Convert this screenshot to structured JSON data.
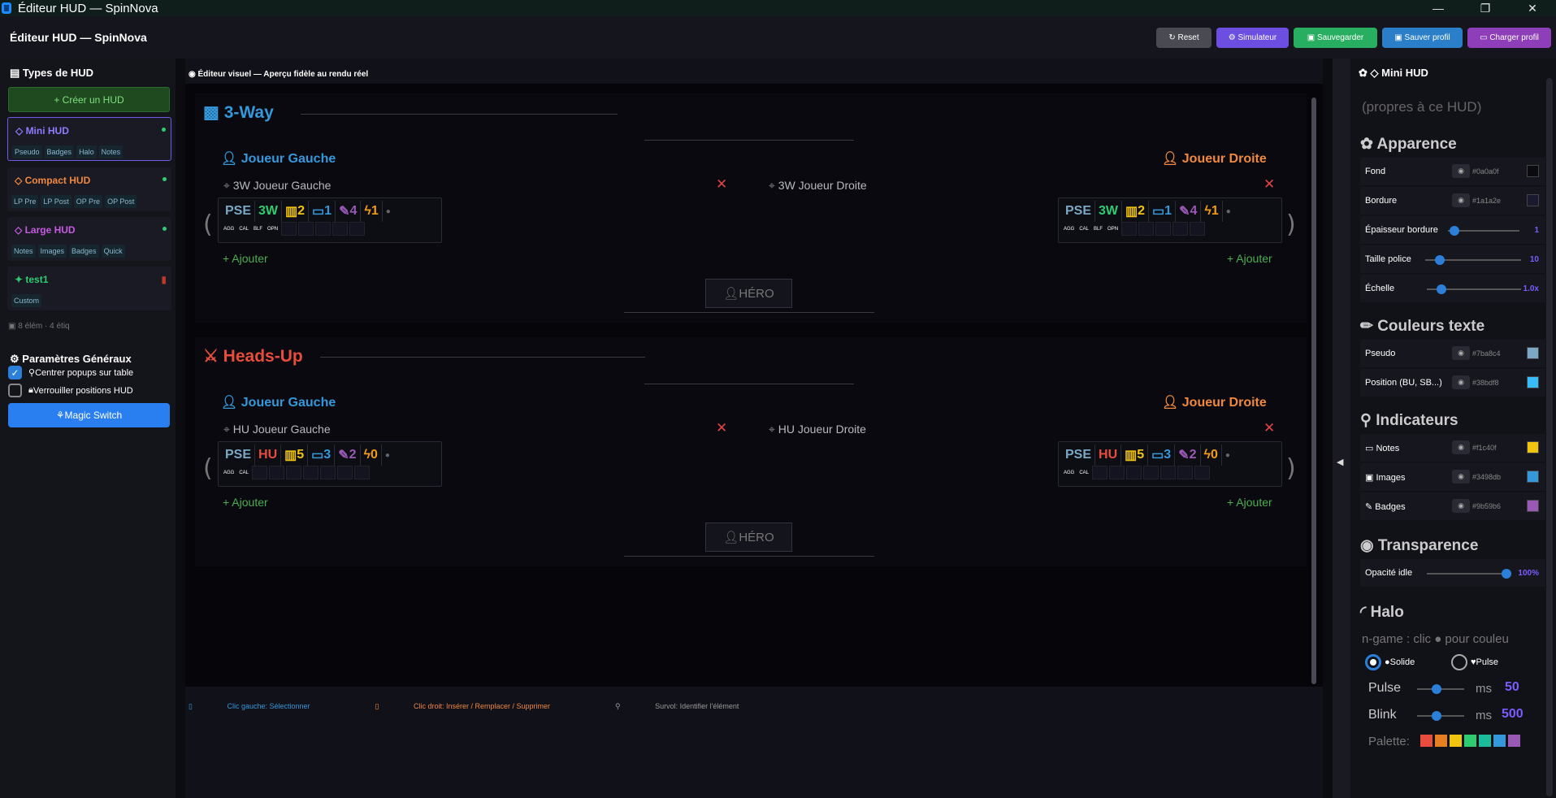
{
  "window": {
    "title": "Éditeur HUD — SpinNova",
    "minimize": "—",
    "maximize": "❐",
    "close": "✕"
  },
  "header": {
    "title": "Éditeur HUD — SpinNova",
    "buttons": [
      "↻ Reset",
      "⚙ Simulateur",
      "▣ Sauvegarder",
      "▣ Sauver profil",
      "▭ Charger profil"
    ]
  },
  "left": {
    "types_title": "Types de HUD",
    "create": "+ Créer un HUD",
    "huds": [
      {
        "name": "Mini HUD",
        "tags": [
          "Pseudo",
          "Badges",
          "Halo",
          "Notes"
        ]
      },
      {
        "name": "Compact HUD",
        "tags": [
          "LP Pre",
          "LP Post",
          "OP Pre",
          "OP Post"
        ]
      },
      {
        "name": "Large HUD",
        "tags": [
          "Notes",
          "Images",
          "Badges",
          "Quick"
        ]
      },
      {
        "name": "test1",
        "tags": [
          "Custom"
        ]
      }
    ],
    "count": "8 élém · 4 étiq",
    "params_title": "Paramètres Généraux",
    "center_popups": "Centrer popups sur table",
    "lock_positions": "Verrouiller positions HUD",
    "magic": "Magic Switch"
  },
  "editor": {
    "title": "Éditeur visuel — Aperçu fidèle au rendu réel",
    "sections": [
      {
        "title": "3-Way",
        "left_player": "Joueur Gauche",
        "right_player": "Joueur Droite",
        "left_name": "3W Joueur Gauche",
        "right_name": "3W Joueur Droite",
        "mode": "3W",
        "badges": [
          "2",
          "1",
          "4",
          "1"
        ],
        "sub": [
          "AGG",
          "CAL",
          "BLF",
          "OPN"
        ],
        "add": "+ Ajouter",
        "hero": "HÉRO"
      },
      {
        "title": "Heads-Up",
        "left_player": "Joueur Gauche",
        "right_player": "Joueur Droite",
        "left_name": "HU Joueur Gauche",
        "right_name": "HU Joueur Droite",
        "mode": "HU",
        "badges": [
          "5",
          "3",
          "2",
          "0"
        ],
        "sub": [
          "AGG",
          "CAL"
        ],
        "add": "+ Ajouter",
        "hero": "HÉRO"
      }
    ],
    "pse": "PSE",
    "status": {
      "left": "Clic gauche: Sélectionner",
      "right": "Clic droit: Insérer / Remplacer / Supprimer",
      "hover": "Survol: Identifier l'élément"
    }
  },
  "right": {
    "title": "Mini HUD",
    "subtitle": "(propres à ce HUD)",
    "appearance": "Apparence",
    "fond": {
      "label": "Fond",
      "hex": "#0a0a0f"
    },
    "bordure": {
      "label": "Bordure",
      "hex": "#1a1a2e"
    },
    "epaisseur": {
      "label": "Épaisseur bordure",
      "value": "1"
    },
    "taille": {
      "label": "Taille police",
      "value": "10"
    },
    "echelle": {
      "label": "Échelle",
      "value": "1.0x"
    },
    "couleurs": "Couleurs texte",
    "pseudo": {
      "label": "Pseudo",
      "hex": "#7ba8c4"
    },
    "position": {
      "label": "Position (BU, SB...)",
      "hex": "#38bdf8"
    },
    "indicateurs": "Indicateurs",
    "notes": {
      "label": "Notes",
      "hex": "#f1c40f"
    },
    "images": {
      "label": "Images",
      "hex": "#3498db"
    },
    "badges": {
      "label": "Badges",
      "hex": "#9b59b6"
    },
    "transparence": "Transparence",
    "opacite": {
      "label": "Opacité idle",
      "value": "100%"
    },
    "halo": "Halo",
    "halo_hint": "n-game : clic ● pour couleu",
    "solide": "Solide",
    "pulse_opt": "Pulse",
    "pulse": {
      "label": "Pulse",
      "unit": "ms",
      "value": "50"
    },
    "blink": {
      "label": "Blink",
      "unit": "ms",
      "value": "500"
    },
    "palette": "Palette:",
    "palette_colors": [
      "#e74c3c",
      "#e67e22",
      "#f1c40f",
      "#2ecc71",
      "#1abc9c",
      "#3498db",
      "#9b59b6"
    ]
  }
}
